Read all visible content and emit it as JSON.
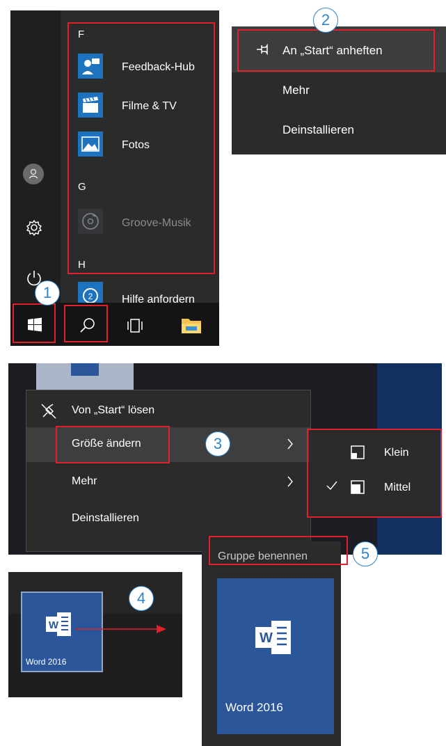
{
  "start_menu": {
    "letters": [
      "F",
      "G",
      "H"
    ],
    "apps": [
      {
        "label": "Feedback-Hub",
        "icon": "feedback-hub-icon"
      },
      {
        "label": "Filme & TV",
        "icon": "movies-tv-icon"
      },
      {
        "label": "Fotos",
        "icon": "photos-icon"
      },
      {
        "label": "Groove-Musik",
        "icon": "groove-music-icon"
      },
      {
        "label": "Hilfe anfordern",
        "icon": "get-help-icon"
      }
    ]
  },
  "context_menu_1": {
    "items": [
      {
        "label": "An „Start“ anheften",
        "icon": "pin-icon"
      },
      {
        "label": "Mehr"
      },
      {
        "label": "Deinstallieren"
      }
    ]
  },
  "context_menu_2": {
    "items": [
      {
        "label": "Von „Start“ lösen",
        "icon": "unpin-icon"
      },
      {
        "label": "Größe ändern"
      },
      {
        "label": "Mehr"
      },
      {
        "label": "Deinstallieren"
      }
    ],
    "submenu": [
      {
        "label": "Klein",
        "checked": false
      },
      {
        "label": "Mittel",
        "checked": true
      }
    ]
  },
  "tile_small": {
    "label": "Word 2016",
    "app_letter": "W"
  },
  "group": {
    "name": "Gruppe benennen"
  },
  "tile_large": {
    "label": "Word 2016",
    "app_letter": "W"
  },
  "badges": [
    "1",
    "2",
    "3",
    "4",
    "5"
  ],
  "colors": {
    "accent": "#1e73be",
    "highlight": "#e0202a",
    "badge": "#2f84c8",
    "word": "#2b579a"
  }
}
